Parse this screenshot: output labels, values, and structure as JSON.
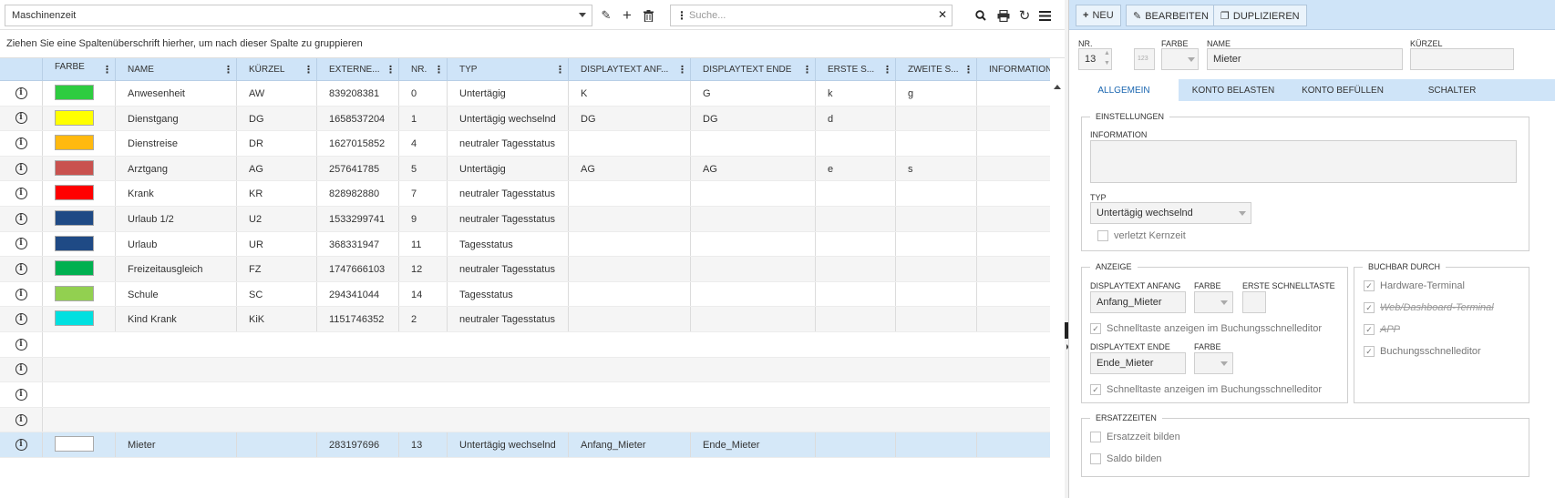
{
  "toolbar": {
    "selected_view": "Maschinenzeit",
    "search_placeholder": "Suche..."
  },
  "group_hint": "Ziehen Sie eine Spaltenüberschrift hierher, um nach dieser Spalte zu gruppieren",
  "grid": {
    "columns": [
      "",
      "Farbe",
      "Name",
      "Kürzel",
      "Externe...",
      "Nr.",
      "Typ",
      "Displaytext Anf...",
      "Displaytext Ende",
      "Erste S...",
      "Zweite S...",
      "Information"
    ],
    "rows": [
      {
        "color": "#2ecc40",
        "name": "Anwesenheit",
        "kuerzel": "AW",
        "extern": "839208381",
        "nr": "0",
        "typ": "Untertägig",
        "anfang": "K",
        "ende": "G",
        "erste": "k",
        "zweite": "g",
        "info": ""
      },
      {
        "color": "#ffff00",
        "name": "Dienstgang",
        "kuerzel": "DG",
        "extern": "1658537204",
        "nr": "1",
        "typ": "Untertägig wechselnd",
        "anfang": "DG",
        "ende": "DG",
        "erste": "d",
        "zweite": "",
        "info": ""
      },
      {
        "color": "#ffb90f",
        "name": "Dienstreise",
        "kuerzel": "DR",
        "extern": "1627015852",
        "nr": "4",
        "typ": "neutraler Tagesstatus",
        "anfang": "",
        "ende": "",
        "erste": "",
        "zweite": "",
        "info": ""
      },
      {
        "color": "#c9524f",
        "name": "Arztgang",
        "kuerzel": "AG",
        "extern": "257641785",
        "nr": "5",
        "typ": "Untertägig",
        "anfang": "AG",
        "ende": "AG",
        "erste": "e",
        "zweite": "s",
        "info": ""
      },
      {
        "color": "#ff0000",
        "name": "Krank",
        "kuerzel": "KR",
        "extern": "828982880",
        "nr": "7",
        "typ": "neutraler Tagesstatus",
        "anfang": "",
        "ende": "",
        "erste": "",
        "zweite": "",
        "info": ""
      },
      {
        "color": "#1f4a85",
        "name": "Urlaub 1/2",
        "kuerzel": "U2",
        "extern": "1533299741",
        "nr": "9",
        "typ": "neutraler Tagesstatus",
        "anfang": "",
        "ende": "",
        "erste": "",
        "zweite": "",
        "info": ""
      },
      {
        "color": "#1f4a85",
        "name": "Urlaub",
        "kuerzel": "UR",
        "extern": "368331947",
        "nr": "11",
        "typ": "Tagesstatus",
        "anfang": "",
        "ende": "",
        "erste": "",
        "zweite": "",
        "info": ""
      },
      {
        "color": "#00b050",
        "name": "Freizeitausgleich",
        "kuerzel": "FZ",
        "extern": "1747666103",
        "nr": "12",
        "typ": "neutraler Tagesstatus",
        "anfang": "",
        "ende": "",
        "erste": "",
        "zweite": "",
        "info": ""
      },
      {
        "color": "#92d050",
        "name": "Schule",
        "kuerzel": "SC",
        "extern": "294341044",
        "nr": "14",
        "typ": "Tagesstatus",
        "anfang": "",
        "ende": "",
        "erste": "",
        "zweite": "",
        "info": ""
      },
      {
        "color": "#00e0e0",
        "name": "Kind Krank",
        "kuerzel": "KiK",
        "extern": "1151746352",
        "nr": "2",
        "typ": "neutraler Tagesstatus",
        "anfang": "",
        "ende": "",
        "erste": "",
        "zweite": "",
        "info": ""
      },
      {
        "empty": true
      },
      {
        "empty": true
      },
      {
        "empty": true
      },
      {
        "empty": true
      },
      {
        "color": "#ffffff",
        "name": "Mieter",
        "kuerzel": "",
        "extern": "283197696",
        "nr": "13",
        "typ": "Untertägig wechselnd",
        "anfang": "Anfang_Mieter",
        "ende": "Ende_Mieter",
        "erste": "",
        "zweite": "",
        "info": "",
        "selected": true
      }
    ]
  },
  "detail": {
    "buttons": {
      "new": "Neu",
      "edit": "Bearbeiten",
      "duplicate": "Duplizieren"
    },
    "labels": {
      "nr": "Nr.",
      "farbe": "Farbe",
      "name": "Name",
      "kuerzel": "Kürzel"
    },
    "values": {
      "nr": "13",
      "nr_hint": "123",
      "name": "Mieter",
      "kuerzel": ""
    },
    "tabs": [
      "Allgemein",
      "Konto belasten",
      "Konto befüllen",
      "Schalter"
    ],
    "einstellungen": {
      "legend": "Einstellungen",
      "information_label": "Information",
      "typ_label": "Typ",
      "typ_value": "Untertägig wechselnd",
      "kernzeit_label": "verletzt Kernzeit"
    },
    "anzeige": {
      "legend": "Anzeige",
      "anfang_label": "Displaytext Anfang",
      "anfang_value": "Anfang_Mieter",
      "farbe_label": "Farbe",
      "schnelltaste_label": "Erste Schnelltaste",
      "anzeigen_label": "Schnelltaste anzeigen im Buchungsschnelleditor",
      "ende_label": "Displaytext Ende",
      "ende_value": "Ende_Mieter",
      "farbe2_label": "Farbe",
      "anzeigen2_label": "Schnelltaste anzeigen im Buchungsschnelleditor"
    },
    "buchbar": {
      "legend": "Buchbar durch",
      "items": [
        "Hardware-Terminal",
        "Web/Dashboard-Terminal",
        "APP",
        "Buchungsschnelleditor"
      ]
    },
    "ersatzzeiten": {
      "legend": "Ersatzzeiten",
      "items": [
        "Ersatzzeit bilden",
        "Saldo bilden"
      ]
    }
  },
  "colors": {
    "accent": "#cfe4f8",
    "selected_row": "#d5e8f8",
    "active_tab_text": "#1a66b0"
  }
}
